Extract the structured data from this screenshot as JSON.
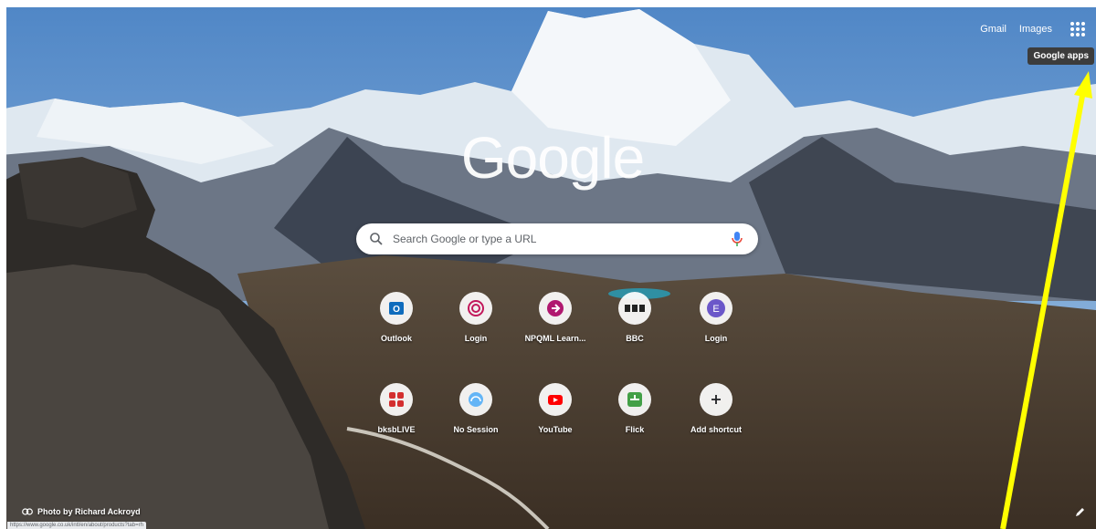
{
  "header": {
    "links": [
      "Gmail",
      "Images"
    ],
    "apps_icon": "google-apps-grid-icon",
    "tooltip": "Google apps"
  },
  "logo": "Google",
  "search": {
    "placeholder": "Search Google or type a URL",
    "icon": "search-icon",
    "voice_icon": "microphone-icon"
  },
  "shortcuts": [
    {
      "label": "Outlook",
      "icon": "outlook-icon",
      "color": "#0f6cbd"
    },
    {
      "label": "Login",
      "icon": "target-ring-icon",
      "color": "#c2185b"
    },
    {
      "label": "NPQML Learn...",
      "icon": "arrow-circle-icon",
      "color": "#b0186f"
    },
    {
      "label": "BBC",
      "icon": "bbc-icon",
      "color": "#222222"
    },
    {
      "label": "Login",
      "icon": "letter-e-icon",
      "color": "#6b57c9"
    },
    {
      "label": "bksbLIVE",
      "icon": "bksb-icon",
      "color": "#d32f2f"
    },
    {
      "label": "No Session",
      "icon": "dashboard-gauge-icon",
      "color": "#64b5f6"
    },
    {
      "label": "YouTube",
      "icon": "youtube-icon",
      "color": "#ff0000"
    },
    {
      "label": "Flick",
      "icon": "flick-icon",
      "color": "#43a047"
    },
    {
      "label": "Add shortcut",
      "icon": "plus-icon",
      "color": "#202124"
    }
  ],
  "footer": {
    "credit": "Photo by Richard Ackroyd",
    "credit_icon": "link-icon",
    "status_url": "https://www.google.co.uk/intl/en/about/products?tab=rh",
    "edit_icon": "pencil-icon"
  },
  "colors": {
    "annotation_arrow": "#ffff00"
  }
}
